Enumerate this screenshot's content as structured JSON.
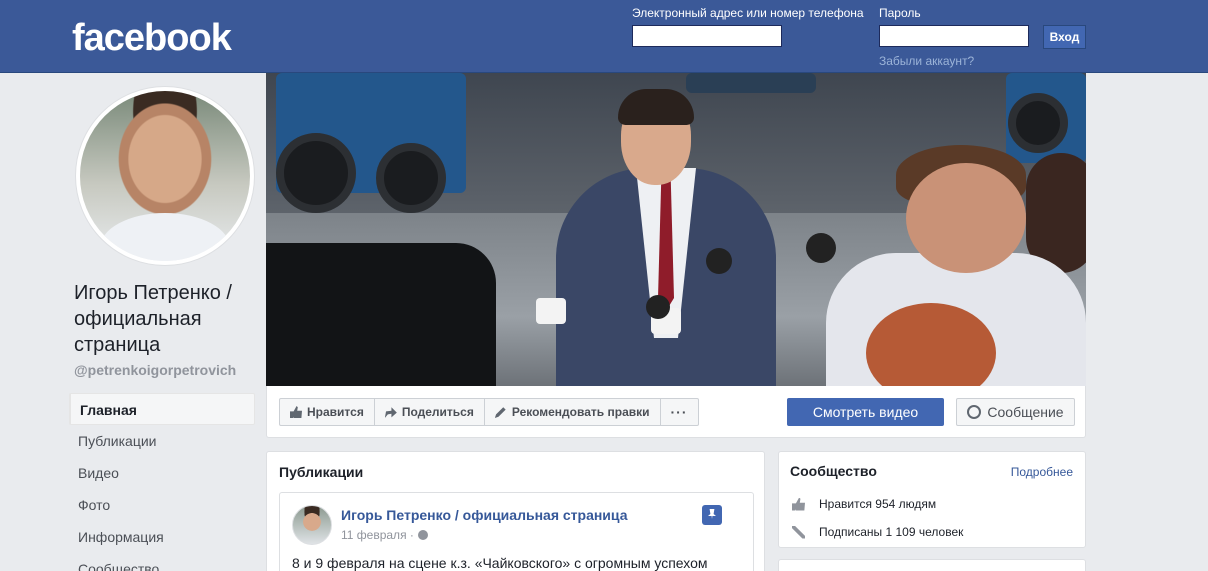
{
  "header": {
    "logo": "facebook",
    "email_label": "Электронный адрес или номер телефона",
    "password_label": "Пароль",
    "login_button": "Вход",
    "forgot_link": "Забыли аккаунт?"
  },
  "profile": {
    "name": "Игорь Петренко / официальная страница",
    "username": "@petrenkoigorpetrovich"
  },
  "nav": {
    "items": [
      {
        "label": "Главная",
        "active": true
      },
      {
        "label": "Публикации"
      },
      {
        "label": "Видео"
      },
      {
        "label": "Фото"
      },
      {
        "label": "Информация"
      },
      {
        "label": "Сообщество"
      }
    ]
  },
  "actions": {
    "like": "Нравится",
    "share": "Поделиться",
    "suggest_edits": "Рекомендовать правки",
    "more": "···",
    "watch_video": "Смотреть видео",
    "message": "Сообщение"
  },
  "posts": {
    "title": "Публикации",
    "post": {
      "author": "Игорь Петренко / официальная страница",
      "date": "11 февраля ·",
      "text": "8 и 9 февраля на сцене к.з. «Чайковского» с огромным успехом"
    }
  },
  "community": {
    "title": "Сообщество",
    "more_link": "Подробнее",
    "likes": "Нравится 954 людям",
    "followers": "Подписаны 1 109 человек"
  },
  "colors": {
    "brand_blue": "#3b5998",
    "button_blue": "#4267b2",
    "link_blue": "#365899"
  }
}
